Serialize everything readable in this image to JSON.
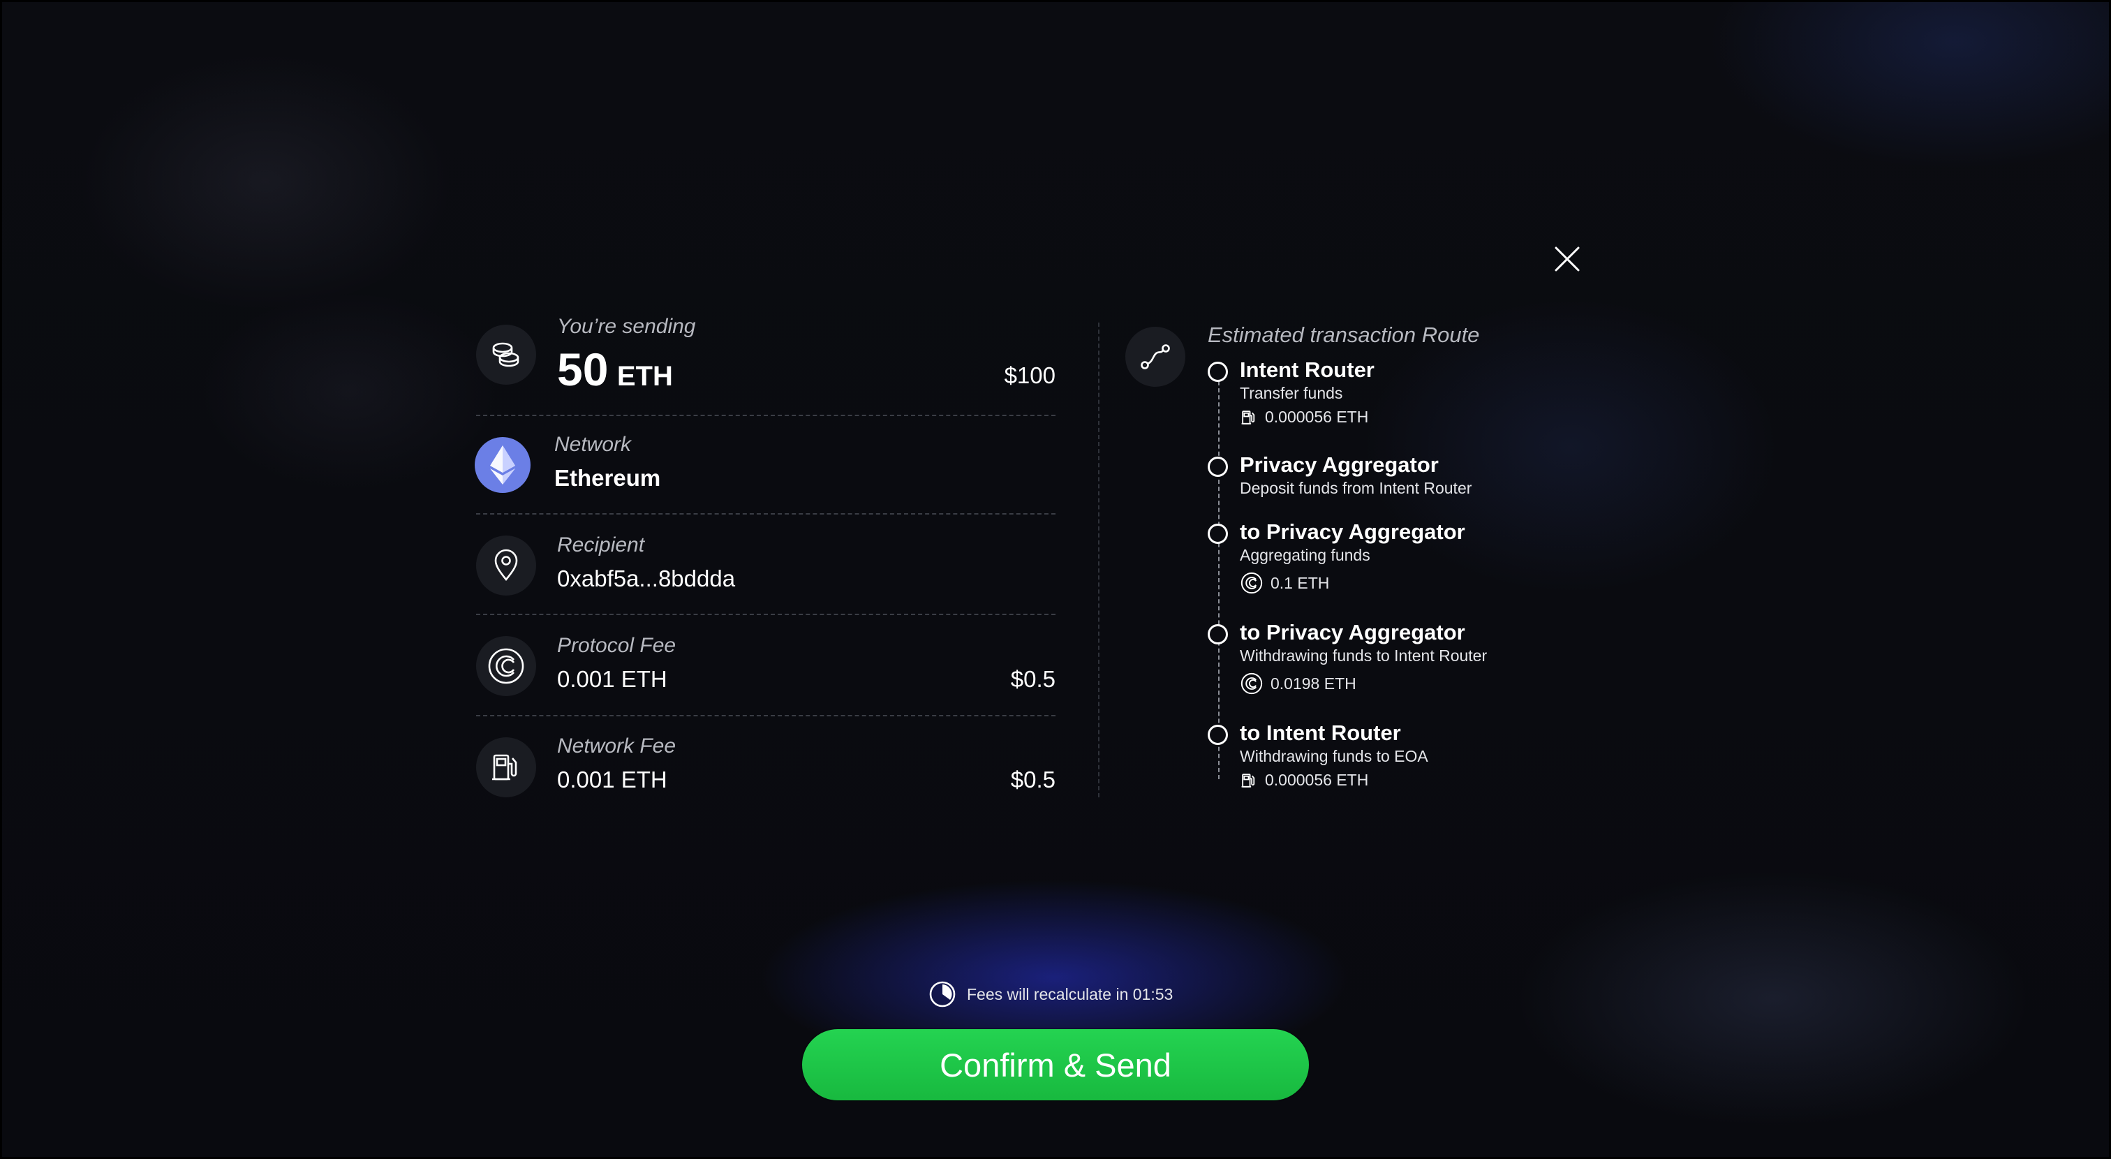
{
  "sending": {
    "label": "You’re sending",
    "amount": "50",
    "unit": "ETH",
    "usd": "$100"
  },
  "network": {
    "label": "Network",
    "value": "Ethereum"
  },
  "recipient": {
    "label": "Recipient",
    "value": "0xabf5a...8bddda"
  },
  "protocol_fee": {
    "label": "Protocol Fee",
    "value": "0.001 ETH",
    "usd": "$0.5"
  },
  "network_fee": {
    "label": "Network Fee",
    "value": "0.001 ETH",
    "usd": "$0.5"
  },
  "route": {
    "title": "Estimated transaction Route",
    "steps": [
      {
        "title": "Intent Router",
        "desc": "Transfer funds",
        "fee": "0.000056 ETH",
        "fee_icon": "gas-pump-icon"
      },
      {
        "title": "Privacy Aggregator",
        "desc": "Deposit funds from Intent Router"
      },
      {
        "title": "to Privacy Aggregator",
        "desc": "Aggregating funds",
        "fee": "0.1 ETH",
        "fee_icon": "protocol-icon"
      },
      {
        "title": "to Privacy Aggregator",
        "desc": "Withdrawing funds to Intent Router",
        "fee": "0.0198 ETH",
        "fee_icon": "protocol-icon"
      },
      {
        "title": "to Intent Router",
        "desc": "Withdrawing funds to EOA",
        "fee": "0.000056 ETH",
        "fee_icon": "gas-pump-icon"
      }
    ]
  },
  "timer": {
    "text": "Fees will recalculate in 01:53"
  },
  "confirm_button": {
    "label": "Confirm & Send"
  },
  "colors": {
    "accent_green": "#1fc74a",
    "eth_blue": "#6b7fe6",
    "background": "#0b0c11"
  }
}
